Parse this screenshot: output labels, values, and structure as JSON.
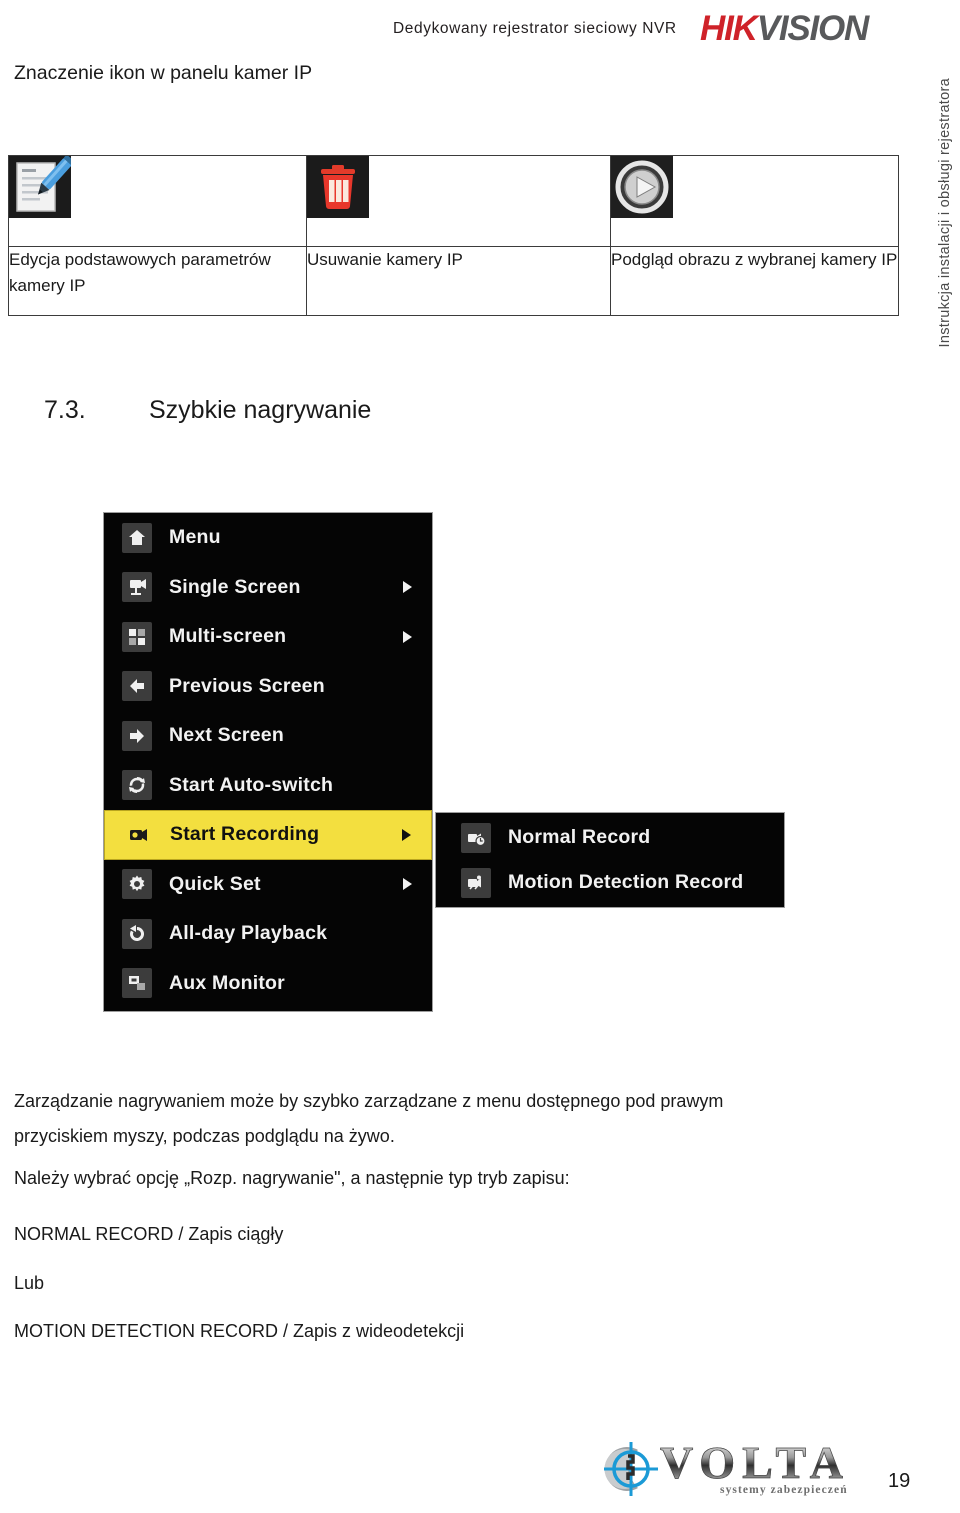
{
  "header": {
    "subtitle": "Dedykowany rejestrator sieciowy NVR",
    "brand_red": "HIK",
    "brand_grey": "VISION",
    "brand_red_color": "#cf2229",
    "brand_grey_color": "#58595b"
  },
  "side_label": {
    "text": "Instrukcja instalacji i obsługi rejestratora"
  },
  "section_heading": "Znaczenie ikon w panelu kamer IP",
  "icon_table": {
    "columns": [
      {
        "icon_name": "edit-document-pen-icon",
        "label": "Edycja podstawowych parametrów kamery IP"
      },
      {
        "icon_name": "delete-trash-icon",
        "label": "Usuwanie kamery IP"
      },
      {
        "icon_name": "play-preview-icon",
        "label": "Podgląd obrazu z wybranej kamery IP"
      }
    ]
  },
  "chapter": {
    "number": "7.3.",
    "title": "Szybkie nagrywanie"
  },
  "nvr_menu": {
    "highlight_color": "#f3df3f",
    "items": [
      {
        "label": "Menu",
        "icon": "home-icon",
        "arrow": false,
        "highlighted": false
      },
      {
        "label": "Single Screen",
        "icon": "single-camera-icon",
        "arrow": true,
        "highlighted": false
      },
      {
        "label": "Multi-screen",
        "icon": "multi-screen-icon",
        "arrow": true,
        "highlighted": false
      },
      {
        "label": "Previous Screen",
        "icon": "arrow-left-icon",
        "arrow": false,
        "highlighted": false
      },
      {
        "label": "Next Screen",
        "icon": "arrow-right-icon",
        "arrow": false,
        "highlighted": false
      },
      {
        "label": "Start Auto-switch",
        "icon": "refresh-cycle-icon",
        "arrow": false,
        "highlighted": false
      },
      {
        "label": "Start Recording",
        "icon": "camcorder-record-icon",
        "arrow": true,
        "highlighted": true
      },
      {
        "label": "Quick Set",
        "icon": "gear-icon",
        "arrow": true,
        "highlighted": false
      },
      {
        "label": "All-day Playback",
        "icon": "playback-rewind-icon",
        "arrow": false,
        "highlighted": false
      },
      {
        "label": "Aux Monitor",
        "icon": "aux-monitor-icon",
        "arrow": false,
        "highlighted": false
      }
    ],
    "submenu": [
      {
        "label": "Normal Record",
        "icon": "normal-record-icon"
      },
      {
        "label": "Motion Detection Record",
        "icon": "motion-record-icon"
      }
    ]
  },
  "body": {
    "p1": "Zarządzanie nagrywaniem może by szybko zarządzane z menu dostępnego pod prawym",
    "p2": "przyciskiem myszy, podczas podglądu na żywo.",
    "p3": "Należy wybrać opcję „Rozp. nagrywanie\", a następnie typ tryb zapisu:",
    "p4": "NORMAL RECORD / Zapis ciągły",
    "p5": "Lub",
    "p6": "MOTION DETECTION RECORD / Zapis  z wideodetekcji"
  },
  "footer": {
    "logo_word": "VOLTA",
    "logo_tagline": "systemy zabezpieczeń",
    "page_number": "19"
  }
}
